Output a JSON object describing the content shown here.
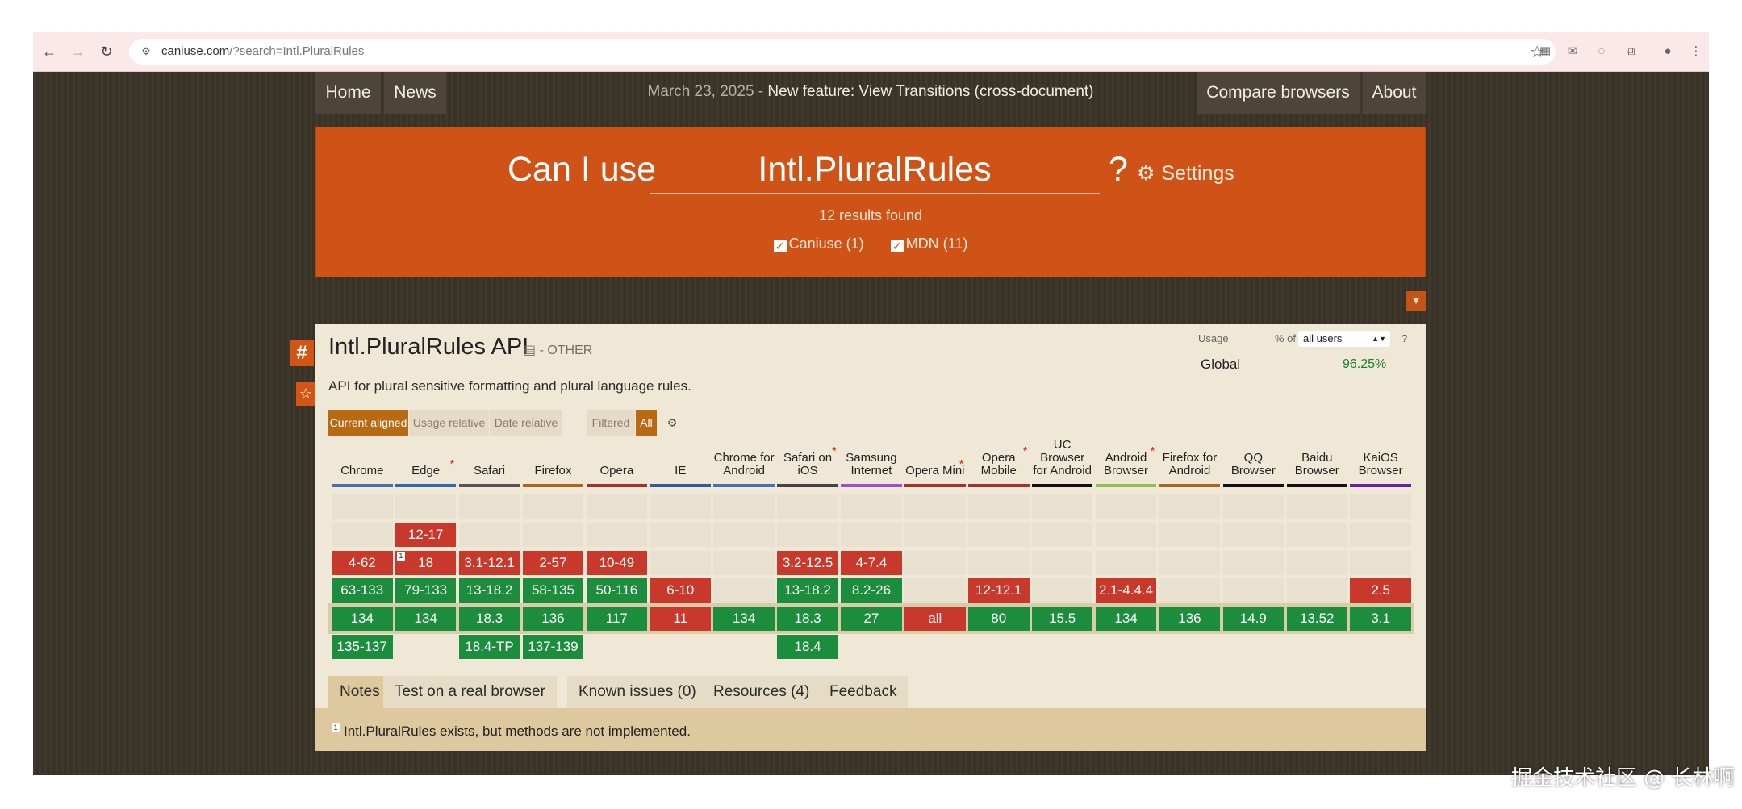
{
  "browser": {
    "url_host": "caniuse.com",
    "url_path": "/?search=Intl.PluralRules",
    "nav": {
      "back": "←",
      "forward": "→",
      "reload": "↻"
    },
    "icons": [
      "bookmark-star-icon",
      "extension-icon",
      "mail-icon",
      "extension-icon",
      "puzzle-icon",
      "profile-icon",
      "menu-icon"
    ]
  },
  "topnav": {
    "home": "Home",
    "news": "News",
    "news_date": "March 23, 2025",
    "news_sep": " - ",
    "news_text": "New feature: View Transitions (cross-document)",
    "compare": "Compare browsers",
    "about": "About"
  },
  "search": {
    "caniuse_label": "Can I use",
    "query": "Intl.PluralRules",
    "qmark": "?",
    "settings": "Settings",
    "results": "12 results found",
    "caniuse_filter": "Caniuse (1)",
    "mdn_filter": "MDN (11)"
  },
  "feature": {
    "title": "Intl.PluralRules API",
    "category": "- OTHER",
    "description": "API for plural sensitive formatting and plural language rules.",
    "usage": {
      "label": "Usage",
      "pct_of": "% of",
      "select": "all users",
      "help": "?",
      "region": "Global",
      "pct": "96.25%"
    },
    "view_tabs": [
      "Current aligned",
      "Usage relative",
      "Date relative",
      "Filtered",
      "All"
    ],
    "colors": {
      "supported": "#1c8c3d",
      "unsupported": "#c8382b",
      "accent": "#cf5316"
    }
  },
  "browsers": [
    {
      "name": "Chrome",
      "star": false,
      "line": "#4a6fb0",
      "rows": [
        "",
        "",
        "4-62",
        "63-133",
        "134",
        "135-137"
      ],
      "cls": [
        "",
        "",
        "red",
        "green",
        "green",
        "green"
      ]
    },
    {
      "name": "Edge",
      "star": true,
      "line": "#2f6ab0",
      "rows": [
        "",
        "12-17",
        "18",
        "79-133",
        "134",
        ""
      ],
      "cls": [
        "",
        "red",
        "red",
        "green",
        "green",
        ""
      ],
      "note": "1"
    },
    {
      "name": "Safari",
      "star": false,
      "line": "#555555",
      "rows": [
        "",
        "",
        "3.1-12.1",
        "13-18.2",
        "18.3",
        "18.4-TP"
      ],
      "cls": [
        "",
        "",
        "red",
        "green",
        "green",
        "green"
      ]
    },
    {
      "name": "Firefox",
      "star": false,
      "line": "#b4631c",
      "rows": [
        "",
        "",
        "2-57",
        "58-135",
        "136",
        "137-139"
      ],
      "cls": [
        "",
        "",
        "red",
        "green",
        "green",
        "green"
      ]
    },
    {
      "name": "Opera",
      "star": false,
      "line": "#a82f2f",
      "rows": [
        "",
        "",
        "10-49",
        "50-116",
        "117",
        ""
      ],
      "cls": [
        "",
        "",
        "red",
        "green",
        "green",
        ""
      ]
    },
    {
      "name": "IE",
      "star": false,
      "line": "#2f5aa0",
      "rows": [
        "",
        "",
        "",
        "6-10",
        "11",
        ""
      ],
      "cls": [
        "",
        "",
        "",
        "red",
        "red",
        ""
      ]
    },
    {
      "name": "Chrome for Android",
      "star": false,
      "line": "#4a6fb0",
      "rows": [
        "",
        "",
        "",
        "",
        "134",
        ""
      ],
      "cls": [
        "",
        "",
        "",
        "",
        "green",
        ""
      ]
    },
    {
      "name": "Safari on iOS",
      "star": true,
      "line": "#444444",
      "rows": [
        "",
        "",
        "3.2-12.5",
        "13-18.2",
        "18.3",
        "18.4"
      ],
      "cls": [
        "",
        "",
        "red",
        "green",
        "green",
        "green"
      ]
    },
    {
      "name": "Samsung Internet",
      "star": false,
      "line": "#9b4fd6",
      "rows": [
        "",
        "",
        "4-7.4",
        "8.2-26",
        "27",
        ""
      ],
      "cls": [
        "",
        "",
        "red",
        "green",
        "green",
        ""
      ]
    },
    {
      "name": "Opera Mini",
      "star": true,
      "line": "#a82f2f",
      "rows": [
        "",
        "",
        "",
        "",
        "all",
        ""
      ],
      "cls": [
        "",
        "",
        "",
        "",
        "red",
        ""
      ]
    },
    {
      "name": "Opera Mobile",
      "star": true,
      "line": "#a82f2f",
      "rows": [
        "",
        "",
        "",
        "12-12.1",
        "80",
        ""
      ],
      "cls": [
        "",
        "",
        "",
        "red",
        "green",
        ""
      ]
    },
    {
      "name": "UC Browser for Android",
      "star": false,
      "line": "#111111",
      "rows": [
        "",
        "",
        "",
        "",
        "15.5",
        ""
      ],
      "cls": [
        "",
        "",
        "",
        "",
        "green",
        ""
      ]
    },
    {
      "name": "Android Browser",
      "star": true,
      "line": "#8bc34a",
      "rows": [
        "",
        "",
        "",
        "2.1-4.4.4",
        "134",
        ""
      ],
      "cls": [
        "",
        "",
        "",
        "red",
        "green",
        ""
      ]
    },
    {
      "name": "Firefox for Android",
      "star": false,
      "line": "#b4631c",
      "rows": [
        "",
        "",
        "",
        "",
        "136",
        ""
      ],
      "cls": [
        "",
        "",
        "",
        "",
        "green",
        ""
      ]
    },
    {
      "name": "QQ Browser",
      "star": false,
      "line": "#111111",
      "rows": [
        "",
        "",
        "",
        "",
        "14.9",
        ""
      ],
      "cls": [
        "",
        "",
        "",
        "",
        "green",
        ""
      ]
    },
    {
      "name": "Baidu Browser",
      "star": false,
      "line": "#111111",
      "rows": [
        "",
        "",
        "",
        "",
        "13.52",
        ""
      ],
      "cls": [
        "",
        "",
        "",
        "",
        "green",
        ""
      ]
    },
    {
      "name": "KaiOS Browser",
      "star": false,
      "line": "#6a1fb0",
      "rows": [
        "",
        "",
        "",
        "2.5",
        "3.1",
        ""
      ],
      "cls": [
        "",
        "",
        "",
        "red",
        "green",
        ""
      ]
    }
  ],
  "info_tabs": [
    "Notes",
    "Test on a real browser",
    "Known issues (0)",
    "Resources (4)",
    "Feedback"
  ],
  "notes": {
    "num": "1",
    "text": "Intl.PluralRules exists, but methods are not implemented."
  },
  "watermark": "掘金技术社区 @ 长林啊"
}
